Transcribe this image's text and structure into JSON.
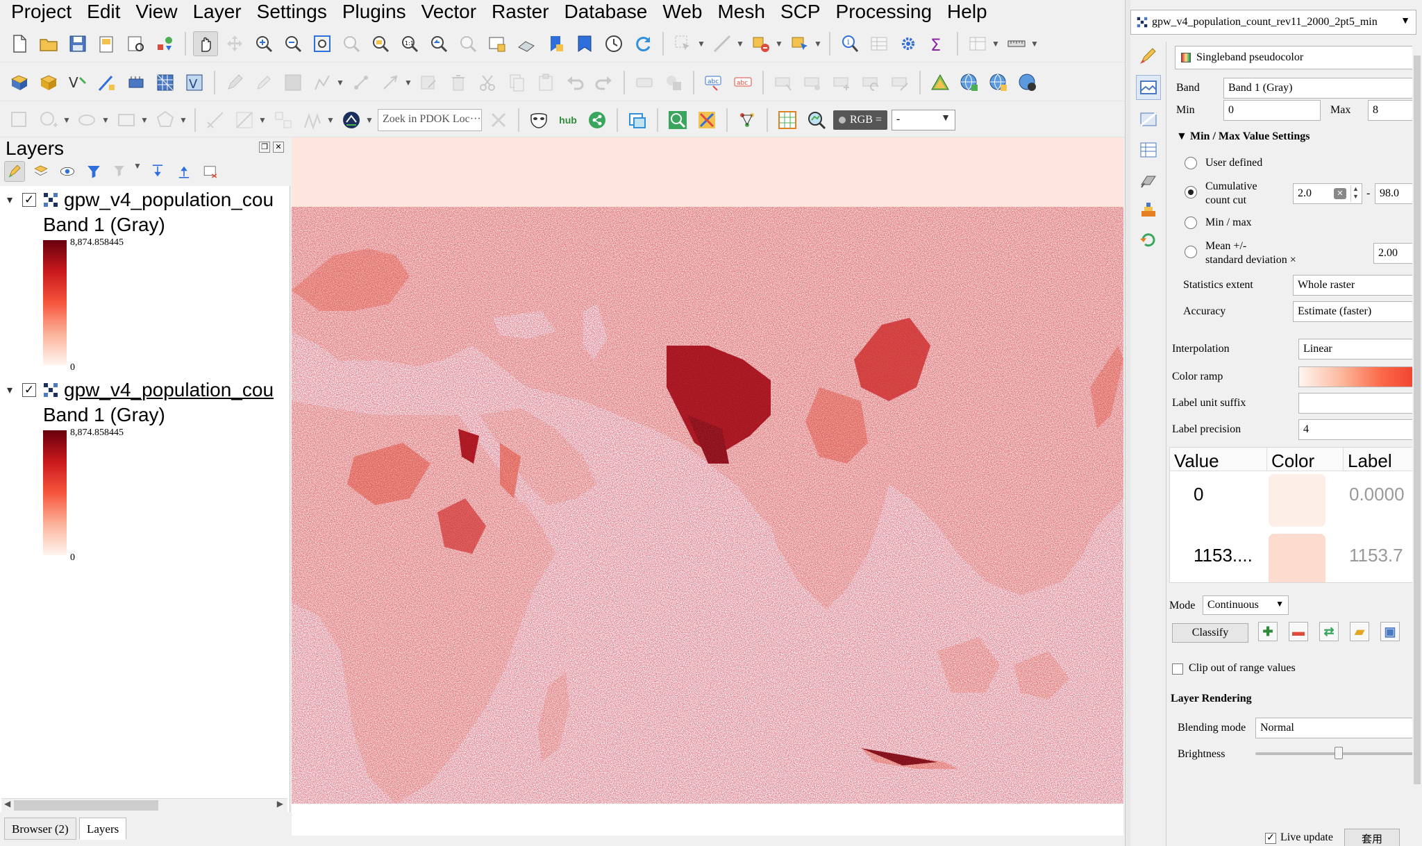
{
  "menubar": {
    "items": [
      "Project",
      "Edit",
      "View",
      "Layer",
      "Settings",
      "Plugins",
      "Vector",
      "Raster",
      "Database",
      "Web",
      "Mesh",
      "SCP",
      "Processing",
      "Help"
    ]
  },
  "toolbar": {
    "pdok_placeholder": "Zoek in PDOK Loc···",
    "hub_label": "hub",
    "rgb_label": "RGB =",
    "rgb_value": "-"
  },
  "layers_panel": {
    "title": "Layers",
    "layers": [
      {
        "name": "gpw_v4_population_cou",
        "band": "Band 1 (Gray)",
        "max": "8,874.858445",
        "min": "0",
        "checked": true
      },
      {
        "name": "gpw_v4_population_cou",
        "band": "Band 1 (Gray)",
        "max": "8,874.858445",
        "min": "0",
        "checked": true
      }
    ],
    "tabs": [
      "Browser (2)",
      "Layers"
    ]
  },
  "style_panel": {
    "layer_combo": "gpw_v4_population_count_rev11_2000_2pt5_min",
    "renderer": "Singleband pseudocolor",
    "band_label": "Band",
    "band_value": "Band 1 (Gray)",
    "min_label": "Min",
    "min_value": "0",
    "max_label": "Max",
    "max_value": "8",
    "minmax_section": "Min / Max Value Settings",
    "options": {
      "user_defined": "User defined",
      "cumulative_line1": "Cumulative",
      "cumulative_line2": "count cut",
      "cumulative_low": "2.0",
      "cumulative_high": "98.0",
      "minmax": "Min / max",
      "mean_line1": "Mean +/-",
      "mean_line2": "standard deviation ×",
      "mean_value": "2.00"
    },
    "statistics_extent_label": "Statistics extent",
    "statistics_extent_value": "Whole raster",
    "accuracy_label": "Accuracy",
    "accuracy_value": "Estimate (faster)",
    "interpolation_label": "Interpolation",
    "interpolation_value": "Linear",
    "color_ramp_label": "Color ramp",
    "label_unit_suffix_label": "Label unit suffix",
    "label_unit_suffix_value": "",
    "label_precision_label": "Label precision",
    "label_precision_value": "4",
    "table": {
      "headers": [
        "Value",
        "Color",
        "Label"
      ],
      "rows": [
        {
          "value": "0",
          "color": "#fdeee8",
          "label": "0.0000"
        },
        {
          "value": "1153....",
          "color": "#fcdccf",
          "label": "1153.7"
        }
      ]
    },
    "mode_label": "Mode",
    "mode_value": "Continuous",
    "classify_label": "Classify",
    "clip_label": "Clip out of range values",
    "layer_rendering": "Layer Rendering",
    "blending_label": "Blending mode",
    "blending_value": "Normal",
    "brightness_label": "Brightness",
    "brightness_level": 0.5,
    "live_update_label": "Live update",
    "apply_label": "套用"
  }
}
